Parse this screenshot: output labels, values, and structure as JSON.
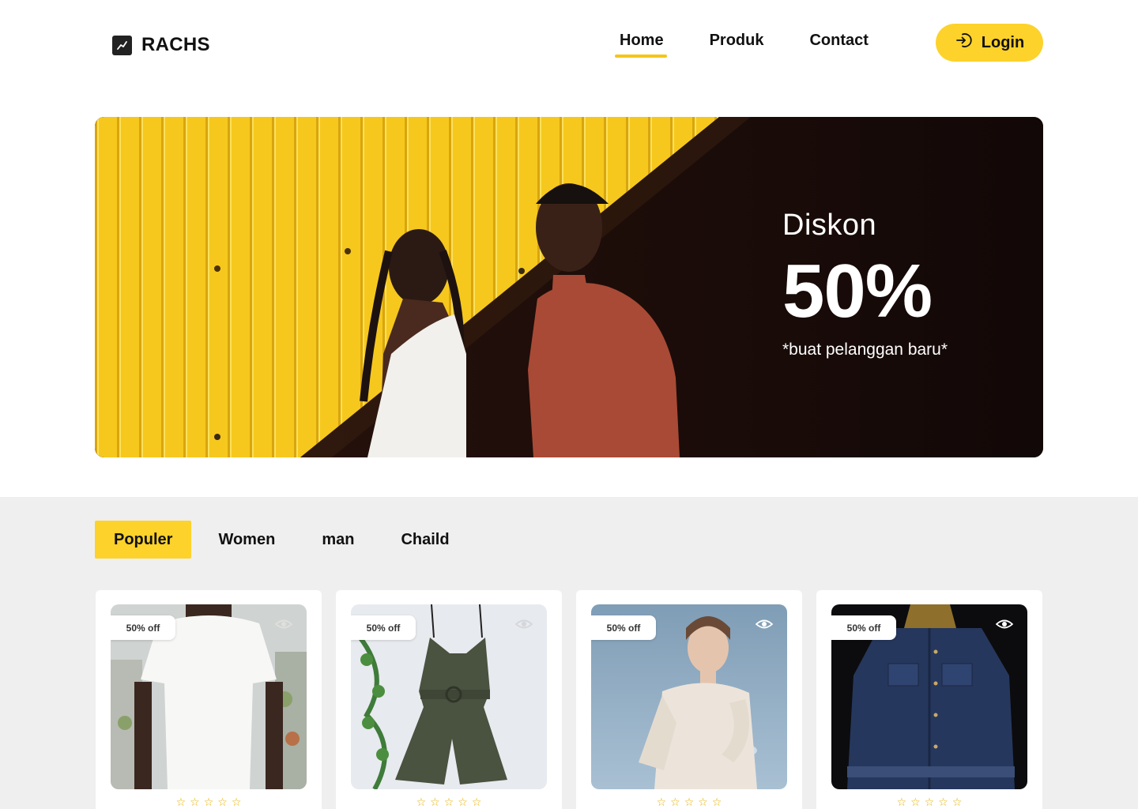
{
  "brand": {
    "name": "RACHS",
    "icon": "trending-chart-icon"
  },
  "nav": {
    "links": [
      "Home",
      "Produk",
      "Contact"
    ],
    "active": "Home",
    "login_label": "Login",
    "login_icon": "sign-in-icon"
  },
  "hero": {
    "kicker": "Diskon",
    "headline": "50%",
    "subtext": "*buat pelanggan baru*"
  },
  "tabs": {
    "items": [
      "Populer",
      "Women",
      "man",
      "Chaild"
    ],
    "active": "Populer"
  },
  "products": [
    {
      "badge": "50% off",
      "image": "white-t-shirt-photo",
      "icon": "eye-icon",
      "rating": 5
    },
    {
      "badge": "50% off",
      "image": "olive-romper-photo",
      "icon": "eye-icon",
      "rating": 5
    },
    {
      "badge": "50% off",
      "image": "cream-knit-cardigan-photo",
      "icon": "eye-icon",
      "rating": 5
    },
    {
      "badge": "50% off",
      "image": "denim-jacket-photo",
      "icon": "eye-icon",
      "rating": 5
    }
  ],
  "colors": {
    "accent": "#fdd22a",
    "section_bg": "#efefef",
    "star": "#e9b000"
  }
}
